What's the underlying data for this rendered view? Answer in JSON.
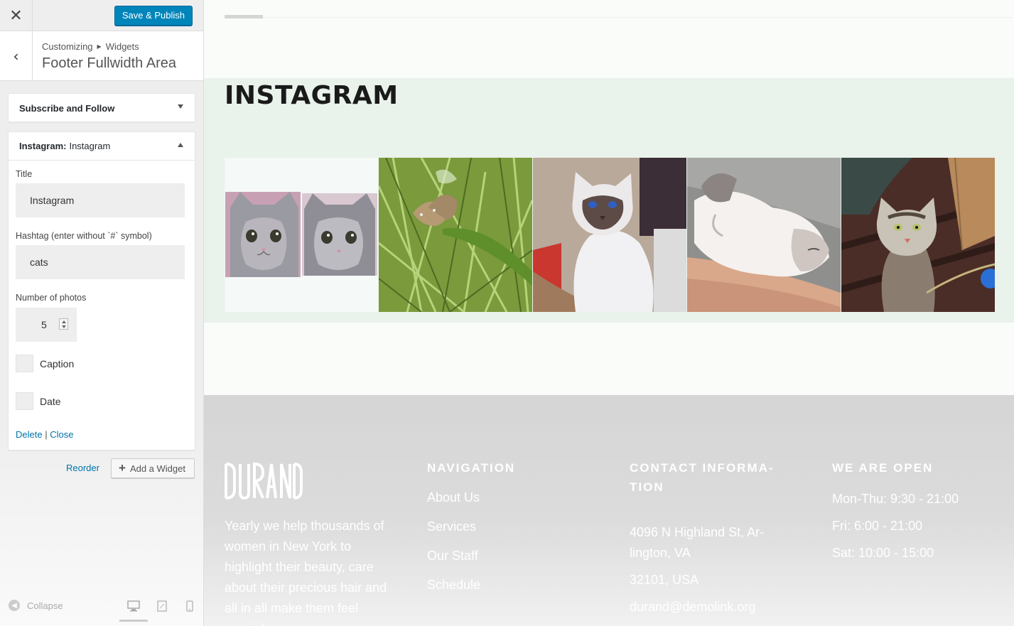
{
  "customizer": {
    "close_icon": "close-icon",
    "publish_label": "Save & Publish",
    "publish_color": "#0085ba",
    "breadcrumb": [
      "Customizing",
      "Widgets"
    ],
    "panel_title": "Footer Fullwidth Area",
    "widgets": [
      {
        "title": "Subscribe and Follow",
        "expanded": false
      },
      {
        "type": "Instagram:",
        "title": "Instagram",
        "expanded": true
      }
    ],
    "form": {
      "title_label": "Title",
      "title_value": "Instagram",
      "hashtag_label": "Hashtag (enter without `#` symbol)",
      "hashtag_value": "cats",
      "photos_label": "Number of photos",
      "photos_value": "5",
      "caption_label": "Caption",
      "caption_checked": false,
      "date_label": "Date",
      "date_checked": false,
      "delete_label": "Delete",
      "separator": "|",
      "close_label": "Close"
    },
    "reorder_label": "Reorder",
    "add_widget_label": "Add a Widget",
    "collapse_label": "Collapse",
    "devices": [
      "desktop",
      "tablet",
      "mobile"
    ],
    "active_device": "desktop"
  },
  "preview": {
    "instagram": {
      "heading": "INSTAGRAM",
      "photos": [
        "cat-kitten-pair-photo",
        "butterfly-grass-photo",
        "siamese-cat-photo",
        "sleeping-cat-arm-photo",
        "tabby-cat-floor-photo"
      ]
    },
    "footer": {
      "logo": "DURAND",
      "tagline": "Yearly we help thousands of women in New York to highlight their beauty, care about their precious hair and all in all make them feel special.",
      "nav_heading": "NAVIGATION",
      "nav_links": [
        "About Us",
        "Services",
        "Our Staff",
        "Schedule"
      ],
      "contact_heading": "CONTACT INFORMA- TION",
      "contact_lines": [
        "4096 N Highland St, Ar- lington, VA",
        "32101, USA",
        "durand@demolink.org"
      ],
      "hours_heading": "WE ARE OPEN",
      "hours": [
        "Mon-Thu: 9:30 - 21:00",
        "Fri: 6:00 - 21:00",
        "Sat: 10:00 - 15:00"
      ]
    }
  }
}
